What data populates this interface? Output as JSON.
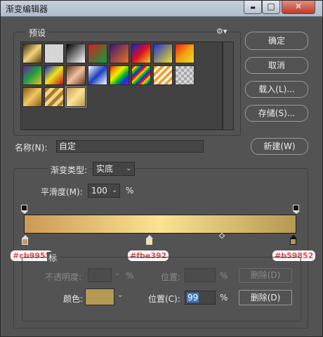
{
  "window": {
    "title": "渐变编辑器"
  },
  "titlebar_buttons": {
    "minimize": "▬",
    "maximize": "□",
    "close": "✕"
  },
  "presets": {
    "title": "预设",
    "gear_label": "⚙▾"
  },
  "buttons": {
    "ok": "确定",
    "cancel": "取消",
    "load": "载入(L)...",
    "save": "存储(S)...",
    "new": "新建(W)"
  },
  "name": {
    "label": "名称(N):",
    "value": "自定"
  },
  "gradient": {
    "type_label": "渐变类型:",
    "type_value": "实底",
    "smoothness_label": "平滑度(M):",
    "smoothness_value": "100",
    "percent": "%",
    "stops": [
      {
        "color": "#cb9955",
        "label": "#cb9955",
        "position": 0
      },
      {
        "color": "#fbe392",
        "label": "#fbe392",
        "position": 50
      },
      {
        "color": "#b59852",
        "label": "#b59852",
        "position": 99
      }
    ]
  },
  "stops_group": {
    "title_fragment": "标"
  },
  "opacity_row": {
    "label": "不透明度:",
    "percent": "%",
    "position_label": "位置:",
    "position_percent": "%",
    "delete_label": "删除(D)"
  },
  "color_row": {
    "label": "颜色:",
    "swatch_color": "#b59852",
    "position_label": "位置(C):",
    "position_value": "99",
    "percent": "%",
    "delete_label": "删除(D)"
  }
}
